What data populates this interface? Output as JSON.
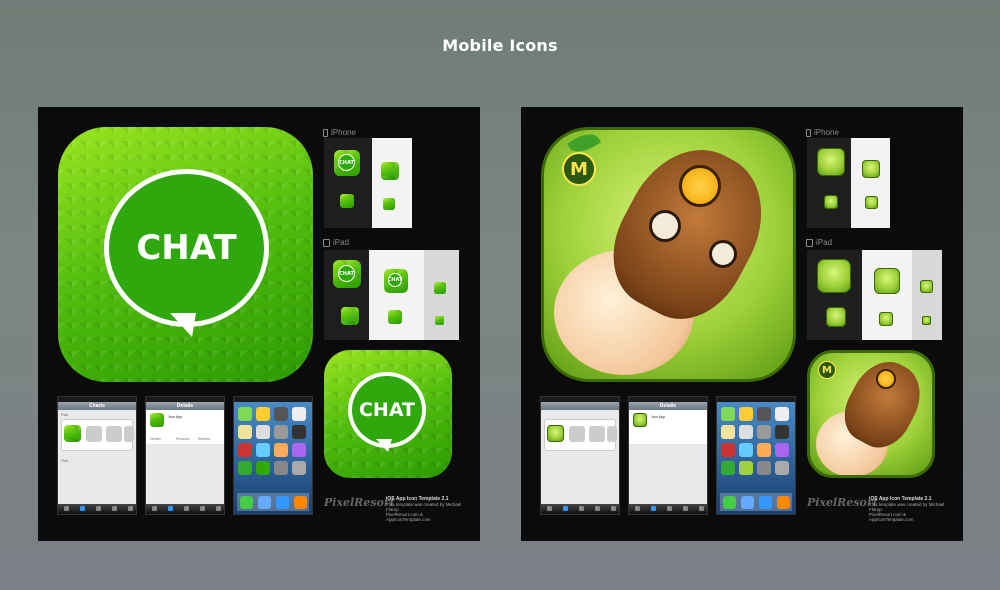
{
  "page": {
    "title": "Mobile Icons"
  },
  "left_sheet": {
    "icon_text": "CHAT",
    "iphone_label": "iPhone",
    "ipad_label": "iPad",
    "phone1": {
      "nav_title": "Charts",
      "section1": "Paid",
      "section2": "Free"
    },
    "phone2": {
      "nav_title": "Details",
      "app_name": "Your App",
      "tabs": [
        "Details",
        "Reviews",
        "Related"
      ]
    },
    "brand": "PixelResort",
    "template_title": "iOS App Icon Template 2.1",
    "template_line1": "This template was created by Michael Flarup",
    "template_line2": "PixelResort.com & AppIconTemplate.com"
  },
  "right_sheet": {
    "badge_letter": "M",
    "iphone_label": "iPhone",
    "ipad_label": "iPad",
    "phone2": {
      "nav_title": "Details",
      "app_name": "Your App"
    },
    "brand": "PixelResort",
    "template_title": "iOS App Icon Template 2.1",
    "template_line1": "This template was created by Michael Flarup",
    "template_line2": "PixelResort.com & AppIconTemplate.com"
  },
  "colors": {
    "chat_green": "#2ea80c",
    "sheet_bg": "#0b0b0b",
    "page_bg": "#76827c"
  }
}
